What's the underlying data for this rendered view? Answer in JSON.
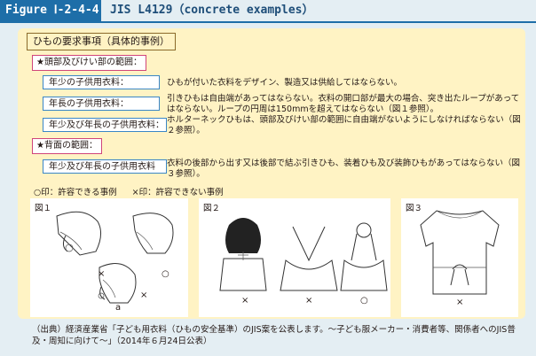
{
  "header": {
    "tag": "Figure Ⅰ-2-4-4",
    "title": "JIS L4129（concrete examples）"
  },
  "panel": {
    "heading": "ひもの要求事項（具体的事例）",
    "section_head_neck": "★頭部及びけい部の範囲：",
    "section_back": "★背面の範囲：",
    "rows": [
      {
        "age": "年少の子供用衣料：",
        "desc": "ひもが付いた衣料をデザイン、製造又は供給してはならない。"
      },
      {
        "age": "年長の子供用衣料：",
        "desc": "引きひもは自由端があってはならない。衣料の開口部が最大の場合、突き出たループがあってはならない。ループの円周は150mmを超えてはならない（図１参照）。"
      },
      {
        "age": "年少及び年長の子供用衣料：",
        "desc": "ホルターネックひもは、頭部及びけい部の範囲に自由端がないようにしなければならない（図２参照）。"
      },
      {
        "age": "年少及び年長の子供用衣料",
        "desc": "衣料の後部から出す又は後部で結ぶ引きひも、装着ひも及び装飾ひもがあってはならない（図３参照）。"
      }
    ],
    "legend_ok": "○印：許容できる事例",
    "legend_ng": "×印：許容できない事例",
    "fig1": {
      "label": "図１",
      "mark_left": "×",
      "mark_right": "○",
      "mark_bottom": "×",
      "sub": "a"
    },
    "fig2": {
      "label": "図２",
      "mark_1": "×",
      "mark_2": "×",
      "mark_3": "○"
    },
    "fig3": {
      "label": "図３",
      "mark": "×"
    }
  },
  "source": "（出典）経済産業省「子ども用衣料（ひもの安全基準）のJIS案を公表します。～子ども服メーカー・消費者等、関係者へのJIS普及・周知に向けて～」（2014年６月24日公表）",
  "colors": {
    "background": "#e4eef3",
    "title_blue": "#1e6ea8",
    "panel_yellow": "#fff3c4",
    "section_pink": "#d0457a",
    "age_blue": "#3a86c6"
  }
}
